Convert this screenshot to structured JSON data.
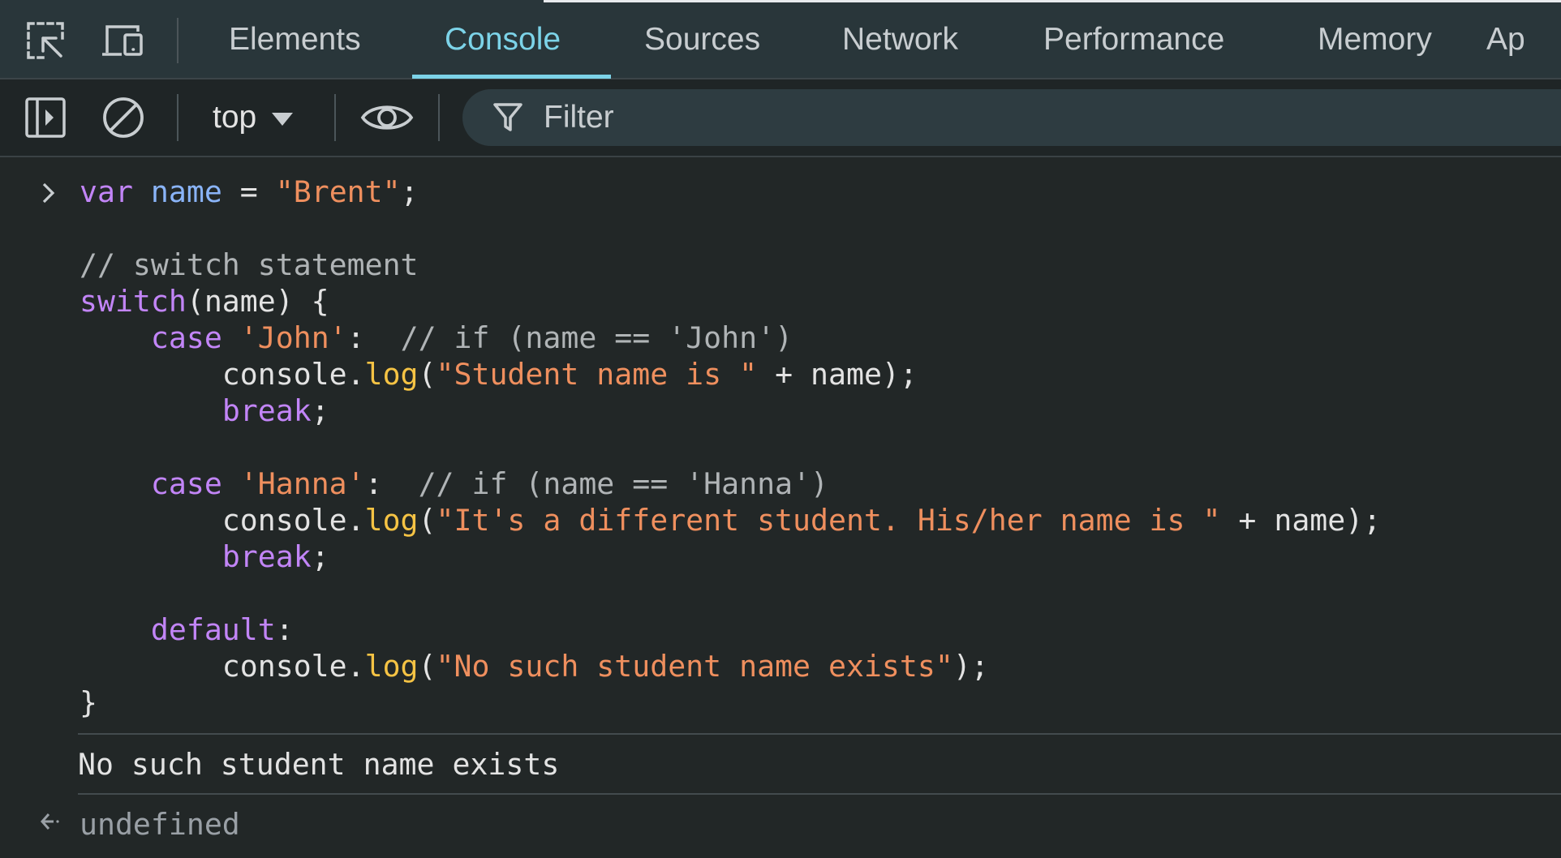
{
  "tabs": [
    {
      "label": "Elements",
      "active": false
    },
    {
      "label": "Console",
      "active": true
    },
    {
      "label": "Sources",
      "active": false
    },
    {
      "label": "Network",
      "active": false
    },
    {
      "label": "Performance",
      "active": false
    },
    {
      "label": "Memory",
      "active": false
    },
    {
      "label": "Ap",
      "active": false
    }
  ],
  "toolbar": {
    "context": "top",
    "filter_placeholder": "Filter"
  },
  "console": {
    "input_lines": [
      [
        {
          "t": "var",
          "c": "kw"
        },
        {
          "t": " ",
          "c": "pl"
        },
        {
          "t": "name",
          "c": "var"
        },
        {
          "t": " = ",
          "c": "pl"
        },
        {
          "t": "\"Brent\"",
          "c": "str"
        },
        {
          "t": ";",
          "c": "pl"
        }
      ],
      [],
      [
        {
          "t": "// switch statement",
          "c": "cm"
        }
      ],
      [
        {
          "t": "switch",
          "c": "kw"
        },
        {
          "t": "(name) {",
          "c": "pl"
        }
      ],
      [
        {
          "t": "    ",
          "c": "pl"
        },
        {
          "t": "case",
          "c": "kw"
        },
        {
          "t": " ",
          "c": "pl"
        },
        {
          "t": "'John'",
          "c": "str"
        },
        {
          "t": ":  ",
          "c": "pl"
        },
        {
          "t": "// if (name == 'John')",
          "c": "cm"
        }
      ],
      [
        {
          "t": "        console.",
          "c": "pl"
        },
        {
          "t": "log",
          "c": "fn"
        },
        {
          "t": "(",
          "c": "pl"
        },
        {
          "t": "\"Student name is \"",
          "c": "str"
        },
        {
          "t": " + name);",
          "c": "pl"
        }
      ],
      [
        {
          "t": "        ",
          "c": "pl"
        },
        {
          "t": "break",
          "c": "kw"
        },
        {
          "t": ";",
          "c": "pl"
        }
      ],
      [],
      [
        {
          "t": "    ",
          "c": "pl"
        },
        {
          "t": "case",
          "c": "kw"
        },
        {
          "t": " ",
          "c": "pl"
        },
        {
          "t": "'Hanna'",
          "c": "str"
        },
        {
          "t": ":  ",
          "c": "pl"
        },
        {
          "t": "// if (name == 'Hanna')",
          "c": "cm"
        }
      ],
      [
        {
          "t": "        console.",
          "c": "pl"
        },
        {
          "t": "log",
          "c": "fn"
        },
        {
          "t": "(",
          "c": "pl"
        },
        {
          "t": "\"It's a different student. His/her name is \"",
          "c": "str"
        },
        {
          "t": " + name);",
          "c": "pl"
        }
      ],
      [
        {
          "t": "        ",
          "c": "pl"
        },
        {
          "t": "break",
          "c": "kw"
        },
        {
          "t": ";",
          "c": "pl"
        }
      ],
      [],
      [
        {
          "t": "    ",
          "c": "pl"
        },
        {
          "t": "default",
          "c": "kw"
        },
        {
          "t": ":",
          "c": "pl"
        }
      ],
      [
        {
          "t": "        console.",
          "c": "pl"
        },
        {
          "t": "log",
          "c": "fn"
        },
        {
          "t": "(",
          "c": "pl"
        },
        {
          "t": "\"No such student name exists\"",
          "c": "str"
        },
        {
          "t": ");",
          "c": "pl"
        }
      ],
      [
        {
          "t": "}",
          "c": "pl"
        }
      ]
    ],
    "output": "No such student name exists",
    "return_value": "undefined"
  },
  "colors": {
    "accent": "#7cd3e8",
    "keyword": "#c285f7",
    "variable": "#8ab4f8",
    "string": "#ef8f5e",
    "comment": "#b0b4b6",
    "function": "#f5c344"
  }
}
